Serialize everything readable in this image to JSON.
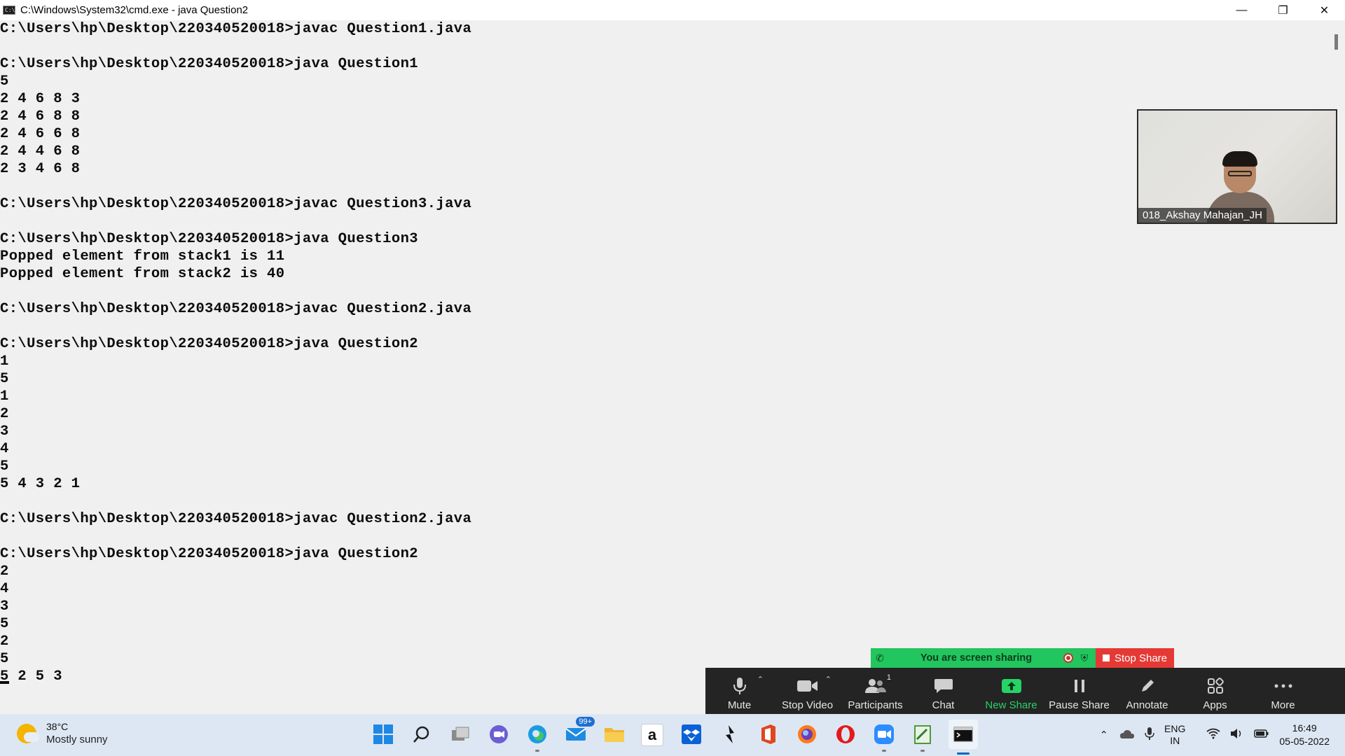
{
  "window": {
    "title": "C:\\Windows\\System32\\cmd.exe - java  Question2",
    "icon_text": "C:\\",
    "controls": [
      "minimize-icon",
      "restore-icon",
      "close-icon"
    ]
  },
  "console": {
    "lines": [
      "C:\\Users\\hp\\Desktop\\220340520018>javac Question1.java",
      "",
      "C:\\Users\\hp\\Desktop\\220340520018>java Question1",
      "5",
      "2 4 6 8 3",
      "2 4 6 8 8",
      "2 4 6 6 8",
      "2 4 4 6 8",
      "2 3 4 6 8",
      "",
      "C:\\Users\\hp\\Desktop\\220340520018>javac Question3.java",
      "",
      "C:\\Users\\hp\\Desktop\\220340520018>java Question3",
      "Popped element from stack1 is 11",
      "Popped element from stack2 is 40",
      "",
      "C:\\Users\\hp\\Desktop\\220340520018>javac Question2.java",
      "",
      "C:\\Users\\hp\\Desktop\\220340520018>java Question2",
      "1",
      "5",
      "1",
      "2",
      "3",
      "4",
      "5",
      "5 4 3 2 1",
      "",
      "C:\\Users\\hp\\Desktop\\220340520018>javac Question2.java",
      "",
      "C:\\Users\\hp\\Desktop\\220340520018>java Question2",
      "2",
      "4",
      "3",
      "5",
      "2",
      "5",
      "5 2 5 3"
    ]
  },
  "video": {
    "participant_name": "018_Akshay Mahajan_JH"
  },
  "share_banner": {
    "text": "You are screen sharing",
    "stop_label": "Stop Share"
  },
  "zoom_toolbar": {
    "items": [
      {
        "label": "Mute",
        "icon": "microphone-icon"
      },
      {
        "label": "Stop Video",
        "icon": "video-camera-icon"
      },
      {
        "label": "Participants",
        "icon": "participants-icon",
        "count": "1"
      },
      {
        "label": "Chat",
        "icon": "chat-icon"
      },
      {
        "label": "New Share",
        "icon": "share-screen-icon"
      },
      {
        "label": "Pause Share",
        "icon": "pause-icon"
      },
      {
        "label": "Annotate",
        "icon": "pencil-icon"
      },
      {
        "label": "Apps",
        "icon": "apps-icon"
      },
      {
        "label": "More",
        "icon": "more-icon"
      }
    ]
  },
  "taskbar": {
    "weather": {
      "temp": "38°C",
      "desc": "Mostly sunny"
    },
    "mail_badge": "99+",
    "amazon_letter": "a",
    "lang": {
      "line1": "ENG",
      "line2": "IN"
    },
    "clock": {
      "time": "16:49",
      "date": "05-05-2022"
    }
  },
  "colors": {
    "console_bg": "#f0f0f0",
    "console_text": "#0c0c0c",
    "share_green": "#22c55e",
    "stop_red": "#e53935",
    "toolbar_bg": "#242424",
    "taskbar_bg": "#dde7f3"
  }
}
